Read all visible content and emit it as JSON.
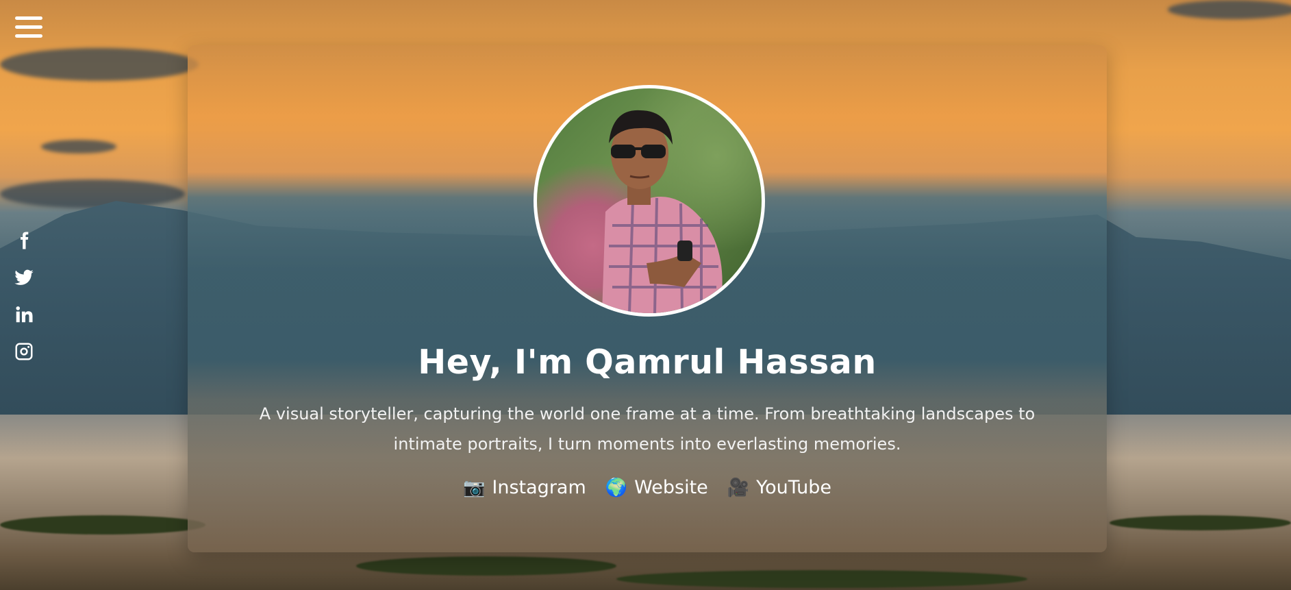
{
  "menu": {
    "icon": "hamburger-menu-icon"
  },
  "social": [
    {
      "name": "facebook",
      "icon": "facebook-icon"
    },
    {
      "name": "twitter",
      "icon": "twitter-icon"
    },
    {
      "name": "linkedin",
      "icon": "linkedin-icon"
    },
    {
      "name": "instagram",
      "icon": "instagram-icon"
    }
  ],
  "profile": {
    "title": "Hey, I'm Qamrul Hassan",
    "bio": "A visual storyteller, capturing the world one frame at a time. From breathtaking landscapes to intimate portraits, I turn moments into everlasting memories."
  },
  "links": [
    {
      "emoji": "📷",
      "label": "Instagram"
    },
    {
      "emoji": "🌍",
      "label": "Website"
    },
    {
      "emoji": "🎥",
      "label": "YouTube"
    }
  ],
  "colors": {
    "text": "#ffffff",
    "sky": "#f0a54c",
    "mountain": "#3f5e6b"
  }
}
